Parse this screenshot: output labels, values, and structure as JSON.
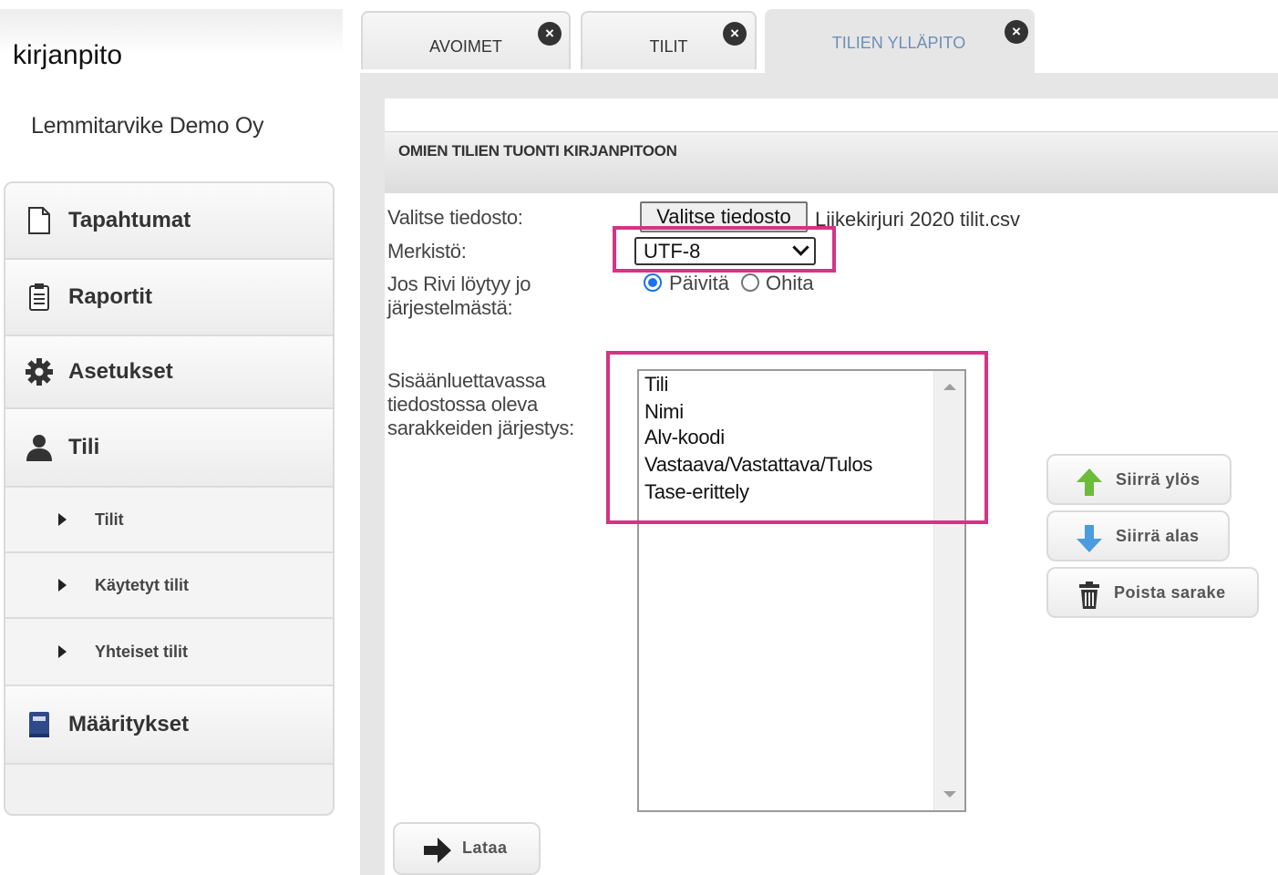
{
  "app": {
    "title": "kirjanpito",
    "company": "Lemmitarvike Demo Oy"
  },
  "sidebar": {
    "items": [
      {
        "label": "Tapahtumat",
        "icon": "document-icon"
      },
      {
        "label": "Raportit",
        "icon": "report-icon"
      },
      {
        "label": "Asetukset",
        "icon": "gear-icon"
      },
      {
        "label": "Tili",
        "icon": "user-icon"
      },
      {
        "label": "Tilit",
        "icon": "caret-right-icon"
      },
      {
        "label": "Käytetyt tilit",
        "icon": "caret-right-icon"
      },
      {
        "label": "Yhteiset tilit",
        "icon": "caret-right-icon"
      },
      {
        "label": "Määritykset",
        "icon": "book-icon"
      }
    ]
  },
  "tabs": [
    {
      "label": "AVOIMET",
      "active": false
    },
    {
      "label": "TILIT",
      "active": false
    },
    {
      "label": "TILIEN YLLÄPITO",
      "active": true
    }
  ],
  "section": {
    "title": "OMIEN TILIEN TUONTI KIRJANPITOON"
  },
  "form": {
    "file_label": "Valitse tiedosto:",
    "file_button": "Valitse tiedosto",
    "file_name": "Liikekirjuri 2020 tilit.csv",
    "charset_label": "Merkistö:",
    "charset_value": "UTF-8",
    "exists_label_1": "Jos Rivi löytyy jo",
    "exists_label_2": "järjestelmästä:",
    "radio_update": "Päivitä",
    "radio_skip": "Ohita",
    "order_label_1": "Sisäänluettavassa",
    "order_label_2": "tiedostossa oleva",
    "order_label_3": "sarakkeiden järjestys:",
    "columns": [
      "Tili",
      "Nimi",
      "Alv-koodi",
      "Vastaava/Vastattava/Tulos",
      "Tase-erittely"
    ]
  },
  "buttons": {
    "move_up": "Siirrä ylös",
    "move_down": "Siirrä alas",
    "remove_column": "Poista sarake",
    "load": "Lataa"
  },
  "colors": {
    "highlight": "#d63384",
    "active_tab_text": "#6d8fb8",
    "arrow_up": "#6dbb3b",
    "arrow_down": "#4a9be0"
  }
}
